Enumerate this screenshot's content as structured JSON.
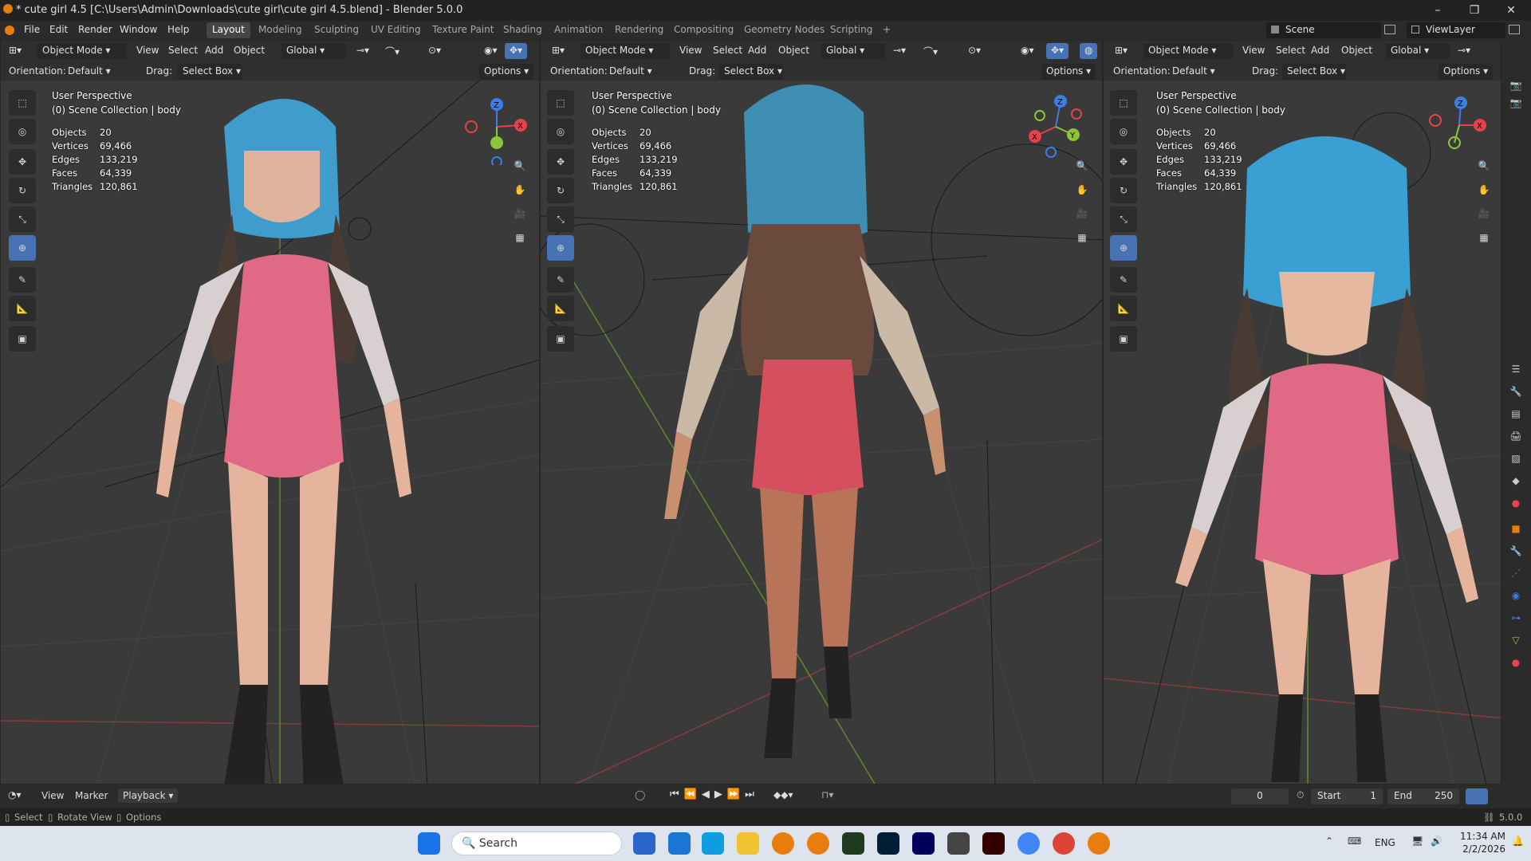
{
  "window": {
    "title": "* cute girl 4.5 [C:\\Users\\Admin\\Downloads\\cute girl\\cute girl 4.5.blend] - Blender 5.0.0",
    "min": "–",
    "max": "❐",
    "close": "✕"
  },
  "menu": [
    "File",
    "Edit",
    "Render",
    "Window",
    "Help"
  ],
  "workspaces": [
    "Layout",
    "Modeling",
    "Sculpting",
    "UV Editing",
    "Texture Paint",
    "Shading",
    "Animation",
    "Rendering",
    "Compositing",
    "Geometry Nodes",
    "Scripting",
    "+"
  ],
  "scene": "Scene",
  "view_layer": "ViewLayer",
  "viewport": {
    "mode": "Object Mode",
    "menus": [
      "View",
      "Select",
      "Add",
      "Object"
    ],
    "transform": "Global",
    "orientation_label": "Orientation:",
    "orientation": "Default",
    "drag_label": "Drag:",
    "drag": "Select Box",
    "options": "Options",
    "view_name": "User Perspective",
    "collection": "(0) Scene Collection | body",
    "stats": [
      {
        "label": "Objects",
        "value": "20"
      },
      {
        "label": "Vertices",
        "value": "69,466"
      },
      {
        "label": "Edges",
        "value": "133,219"
      },
      {
        "label": "Faces",
        "value": "64,339"
      },
      {
        "label": "Triangles",
        "value": "120,861"
      }
    ],
    "axes": {
      "x": "X",
      "y": "Y",
      "z": "Z"
    }
  },
  "timeline": {
    "menus": [
      "View",
      "Marker",
      "Playback"
    ],
    "frame": "0",
    "start_label": "Start",
    "start": "1",
    "end_label": "End",
    "end": "250"
  },
  "status": {
    "select": "Select",
    "rotate": "Rotate View",
    "options": "Options",
    "version": "5.0.0"
  },
  "taskbar": {
    "search": "Search",
    "lang": "ENG",
    "time": "11:34 AM",
    "date": "2/2/2026"
  },
  "colors": {
    "accent": "#4772b3",
    "x_axis": "#e8414b",
    "y_axis": "#8cc43a",
    "z_axis": "#3b7ee8",
    "orange": "#e87d0d"
  }
}
